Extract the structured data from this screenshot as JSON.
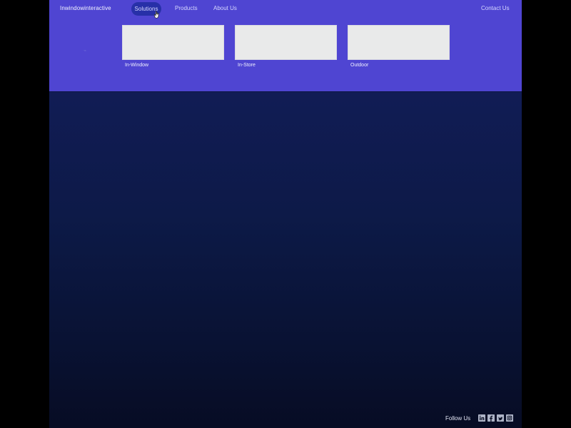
{
  "header": {
    "logo": "Inwindowinteractive",
    "nav": {
      "solutions": "Solutions",
      "products": "Products",
      "about": "About Us",
      "contact": "Contact Us"
    }
  },
  "mega_menu": {
    "items": [
      {
        "label": "In-Window"
      },
      {
        "label": "In-Store"
      },
      {
        "label": "Outdoor"
      }
    ]
  },
  "footer": {
    "follow": "Follow Us",
    "social_icons": [
      "linkedin-icon",
      "facebook-icon",
      "twitter-icon",
      "instagram-icon"
    ]
  },
  "colors": {
    "menu_background": "#4f45d2",
    "active_nav_pill": "#2730a8",
    "page_background_top": "#111c55",
    "page_background_bottom": "#070c24",
    "card_background": "#e9eaea"
  }
}
